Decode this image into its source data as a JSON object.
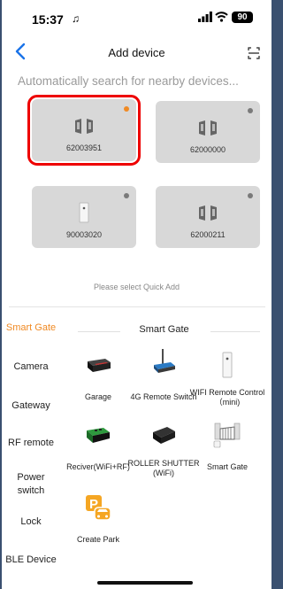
{
  "status": {
    "time": "15:37",
    "battery": "90"
  },
  "nav": {
    "title": "Add device"
  },
  "subtitle": "Automatically search for nearby devices...",
  "devices": [
    {
      "code": "62003951"
    },
    {
      "code": "62000000"
    },
    {
      "code": "90003020"
    },
    {
      "code": "62000211"
    }
  ],
  "hint": "Please select Quick Add",
  "sidebar": {
    "items": [
      "Smart Gate",
      "Camera",
      "Gateway",
      "RF remote",
      "Power switch",
      "Lock",
      "BLE Device"
    ]
  },
  "section": {
    "title": "Smart Gate"
  },
  "products": [
    {
      "label": "Garage"
    },
    {
      "label": "4G Remote Switch"
    },
    {
      "label": "WIFI Remote Control（mini)"
    },
    {
      "label": "Reciver(WiFi+RF)"
    },
    {
      "label": "ROLLER SHUTTER (WiFi)"
    },
    {
      "label": "Smart Gate"
    },
    {
      "label": "Create Park"
    }
  ],
  "colors": {
    "accent": "#f08a24",
    "selection": "#e00000",
    "back": "#1a73e8"
  }
}
